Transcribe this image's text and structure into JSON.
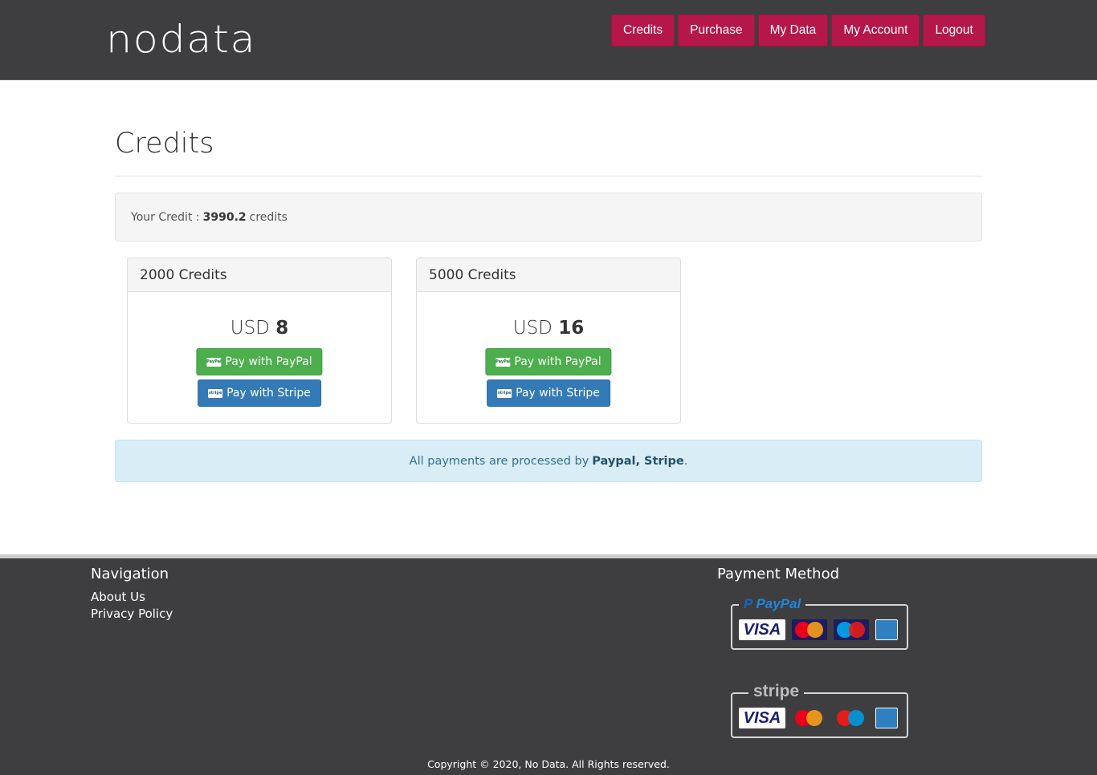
{
  "header": {
    "logo": "nodata",
    "nav": [
      {
        "label": "Credits"
      },
      {
        "label": "Purchase"
      },
      {
        "label": "My Data"
      },
      {
        "label": "My Account"
      },
      {
        "label": "Logout"
      }
    ]
  },
  "main": {
    "title": "Credits",
    "credit": {
      "label": "Your Credit :",
      "value": "3990.2",
      "unit": "credits"
    },
    "packages": [
      {
        "heading": "2000 Credits",
        "currency": "USD",
        "price": "8",
        "paypal_label": "Pay with PayPal",
        "stripe_label": "Pay with Stripe"
      },
      {
        "heading": "5000 Credits",
        "currency": "USD",
        "price": "16",
        "paypal_label": "Pay with PayPal",
        "stripe_label": "Pay with Stripe"
      }
    ],
    "notice": {
      "text": "All payments are processed by",
      "processors": "Paypal, Stripe",
      "suffix": "."
    }
  },
  "footer": {
    "navigation": {
      "heading": "Navigation",
      "links": [
        {
          "label": "About Us"
        },
        {
          "label": "Privacy Policy"
        }
      ]
    },
    "payment": {
      "heading": "Payment Method",
      "paypal_brand": "PayPal",
      "stripe_brand": "stripe",
      "card_visa": "VISA"
    },
    "copyright": "Copyright © 2020, No Data. All Rights reserved."
  },
  "colors": {
    "header_bg": "#3e3e40",
    "nav_accent": "#b5174a",
    "paypal_green": "#4cae4c",
    "stripe_blue": "#337ab7",
    "info_bg": "#d9edf7"
  }
}
